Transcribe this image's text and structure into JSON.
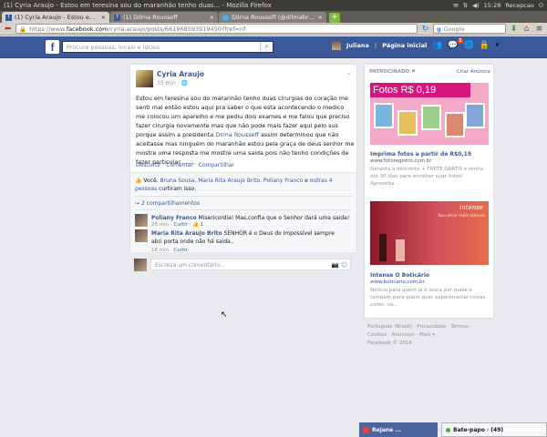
{
  "window": {
    "title": "(1) Cyria Araujo - Estou em teresina sou do maranhão tenho duas... - Mozilla Firefox",
    "tray_time": "15:28",
    "tray_user": "Recepcao"
  },
  "browser": {
    "tabs": [
      {
        "label": "(1) Cyria Araujo - Estou em t...",
        "active": true
      },
      {
        "label": "(1) Dilma Rousseff",
        "active": false
      },
      {
        "label": "Dilma Rousseff (@dilmabr) ...",
        "active": false
      }
    ],
    "new_tab": "+",
    "url_prefix": "https://www.",
    "url_domain": "facebook.com",
    "url_path": "/cyria.araujo/posts/661968593919450?fref=nf",
    "search_engine": "Google",
    "search_placeholder": "Google"
  },
  "fb": {
    "logo": "f",
    "search_placeholder": "Procure pessoas, locais e locais",
    "user_name": "Juliana",
    "home_label": "Página inicial",
    "notif_count": "1"
  },
  "post": {
    "author": "Cyria Araujo",
    "time": "35 min · ",
    "text_before": "Estou em teresina sou do maranhão tenho duas cirurgias do coração me senti mal então estou aqui pra saber o que esta acontecendo o medico me colocou um aparelho e me pediu dois exames e me falou que preciso fazer cirurgia novamente mas que não pode mais fazer aqui pelo sus porque assim a presidenta ",
    "mention": "Dilma Rousseff",
    "text_after": " assim determinou que não aceitasse mas ninguém do maranhão estou pela graça de deus senhor me mostre uma resposta me mostre uma saida pois não tenho condições de fazer particular........",
    "actions": [
      "Descurtir",
      "Comentar",
      "Compartilhar"
    ],
    "likes_prefix": "Você, ",
    "likes_names": "Bruna Sousa, Maria Rita Araujo Brito, Poliany Franco",
    "likes_mid": " e ",
    "likes_others": "outras 4 pessoas",
    "likes_suffix": " curtiram isso.",
    "shares": "2 compartilhamentos"
  },
  "comments": [
    {
      "author": "Poliany Franco",
      "text": " Misericordia! Mas,confia que o Senhor dará uma saida!",
      "time": "26 min · ",
      "reply": "Curtir",
      "likes": " · 👍 1"
    },
    {
      "author": "Maria Rita Araujo Brito",
      "text": " SENHOR é o Deus do impossível sempre abri porta onde não há saida..",
      "time": "18 min · ",
      "reply": "Curtir",
      "likes": ""
    }
  ],
  "comment_input": {
    "placeholder": "Escreva um comentário..."
  },
  "sidebar": {
    "sponsored": "PATROCINADO",
    "create_ad": "Criar Anúncio",
    "ads": [
      {
        "banner": "Fotos R$ 0,19",
        "title": "Imprima fotos a partir de R$0,19",
        "url": "www.fotoregistro.com.br",
        "desc": "Garanta o desconto + FRETE GRÁTIS e tenha até 30 dias para escolher suas fotos! Aproveita..."
      },
      {
        "banner": "intense",
        "banner_sub": "Seu olhar mais intenso",
        "title": "Intense O Boticário",
        "url": "www.boticario.com.br",
        "desc": "Notícia para quem já é louca por make e também para quem quer experimentar novas cores: na..."
      }
    ]
  },
  "footer": {
    "line1": "Português (Brasil) · Privacidade · Termos ·",
    "line2": "Cookies · Anúncios · Mais ▾",
    "line3": "Facebook © 2014"
  },
  "chat": {
    "tab1": "Rejane ...",
    "tab2": "Bate-papo · (49)"
  },
  "colors": {
    "fb_blue": "#3b5998",
    "link": "#3b5998",
    "page_bg": "#e9eaed"
  }
}
